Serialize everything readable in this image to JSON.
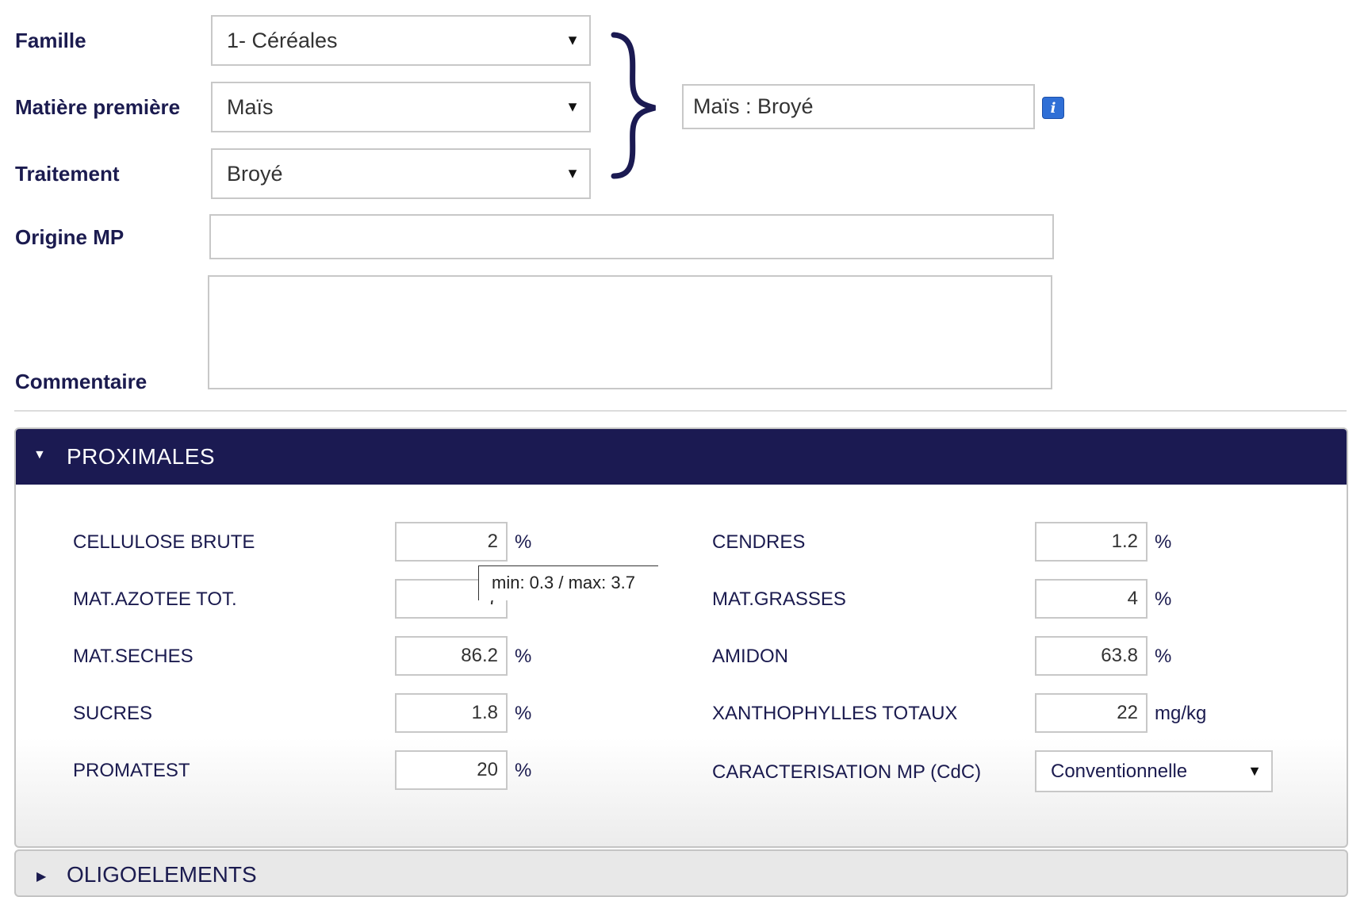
{
  "form": {
    "famille": {
      "label": "Famille",
      "value": "1- Céréales"
    },
    "matiere": {
      "label": "Matière première",
      "value": "Maïs"
    },
    "traitement": {
      "label": "Traitement",
      "value": "Broyé"
    },
    "combined": {
      "value": "Maïs : Broyé"
    },
    "origine": {
      "label": "Origine MP",
      "value": ""
    },
    "commentaire": {
      "label": "Commentaire",
      "value": ""
    }
  },
  "icons": {
    "dropdown": "▼",
    "info": "i",
    "brace": "}",
    "expanded": "▼",
    "collapsed": "▶"
  },
  "proximales": {
    "title": "PROXIMALES",
    "left": [
      {
        "label": "CELLULOSE BRUTE",
        "value": "2",
        "unit": "%"
      },
      {
        "label": "MAT.AZOTEE TOT.",
        "value": "7",
        "unit": ""
      },
      {
        "label": "MAT.SECHES",
        "value": "86.2",
        "unit": "%"
      },
      {
        "label": "SUCRES",
        "value": "1.8",
        "unit": "%"
      },
      {
        "label": "PROMATEST",
        "value": "20",
        "unit": "%"
      }
    ],
    "right": [
      {
        "label": "CENDRES",
        "value": "1.2",
        "unit": "%"
      },
      {
        "label": "MAT.GRASSES",
        "value": "4",
        "unit": "%"
      },
      {
        "label": "AMIDON",
        "value": "63.8",
        "unit": "%"
      },
      {
        "label": "XANTHOPHYLLES TOTAUX",
        "value": "22",
        "unit": "mg/kg"
      },
      {
        "label": "CARACTERISATION MP (CdC)",
        "value": "Conventionnelle"
      }
    ],
    "tooltip": "min: 0.3 / max: 3.7"
  },
  "oligoelements": {
    "title": "OLIGOELEMENTS"
  },
  "colors": {
    "header_bg": "#1b1a52",
    "label_text": "#1b1b4f",
    "info_blue": "#2f6fd6"
  }
}
